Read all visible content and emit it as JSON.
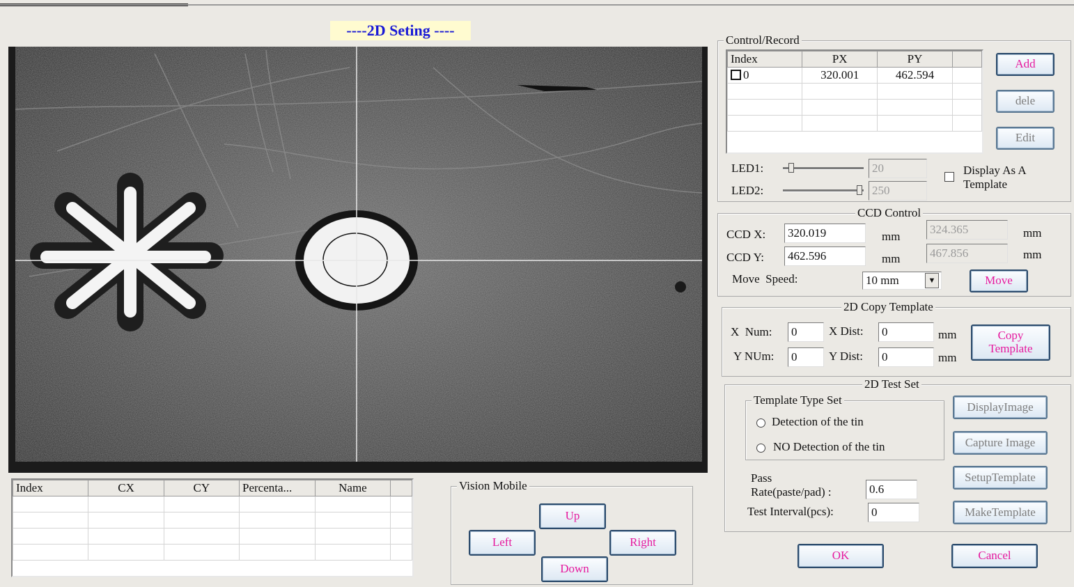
{
  "title": "----2D Seting ----",
  "control_record": {
    "legend": "Control/Record",
    "columns": [
      "Index",
      "PX",
      "PY"
    ],
    "rows": [
      {
        "index": "0",
        "px": "320.001",
        "py": "462.594"
      }
    ],
    "add_label": "Add",
    "dele_label": "dele",
    "edit_label": "Edit",
    "led1_label": "LED1:",
    "led1_value": "20",
    "led2_label": "LED2:",
    "led2_value": "250",
    "display_template_label": "Display As A Template"
  },
  "ccd_control": {
    "legend": "CCD Control",
    "x_label": "CCD X:",
    "x_value": "320.019",
    "x_readout": "324.365",
    "y_label": "CCD Y:",
    "y_value": "462.596",
    "y_readout": "467.856",
    "unit": "mm",
    "speed_label": "Move  Speed:",
    "speed_value": "10 mm",
    "move_label": "Move"
  },
  "copy_template": {
    "legend": "2D Copy Template",
    "x_num_label": "X  Num:",
    "x_num_value": "0",
    "x_dist_label": "X Dist:",
    "x_dist_value": "0",
    "y_num_label": "Y NUm:",
    "y_num_value": "0",
    "y_dist_label": "Y Dist:",
    "y_dist_value": "0",
    "unit": "mm",
    "copy_label": "Copy Template"
  },
  "test_set": {
    "legend": "2D Test Set",
    "template_type_legend": "Template Type Set",
    "radio_detect": "Detection of the tin",
    "radio_no_detect": "NO Detection of the tin",
    "pass_rate_label_1": "Pass",
    "pass_rate_label_2": "Rate(paste/pad) :",
    "pass_rate_value": "0.6",
    "interval_label": "Test Interval(pcs):",
    "interval_value": "0",
    "display_image_label": "DisplayImage",
    "capture_image_label": "Capture Image",
    "setup_template_label": "SetupTemplate",
    "make_template_label": "MakeTemplate"
  },
  "ok_label": "OK",
  "cancel_label": "Cancel",
  "results_grid": {
    "columns": [
      "Index",
      "CX",
      "CY",
      "Percenta...",
      "Name"
    ]
  },
  "vision_mobile": {
    "legend": "Vision Mobile",
    "up": "Up",
    "left": "Left",
    "right": "Right",
    "down": "Down"
  },
  "colors": {
    "title_text": "#1a1ad6",
    "title_bg": "#fffbd0",
    "button_text": "#e6199e",
    "dialog_bg": "#ebe9e4"
  }
}
